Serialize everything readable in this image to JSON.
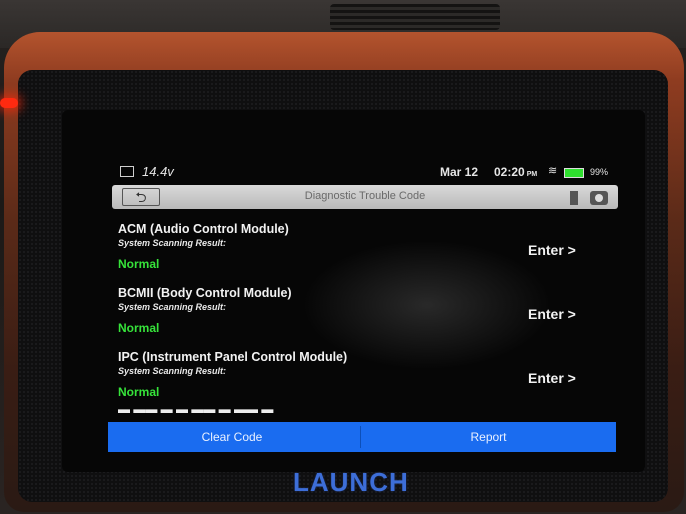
{
  "status_bar": {
    "voltage": "14.4v",
    "date": "Mar 12",
    "time": "02:20",
    "ampm": "PM",
    "battery": "99%"
  },
  "header": {
    "back_glyph": "⮌",
    "title": "Diagnostic Trouble Code"
  },
  "modules": [
    {
      "name": "ACM (Audio Control Module)",
      "sub": "System Scanning Result:",
      "status": "Normal",
      "enter": "Enter >"
    },
    {
      "name": "BCMII (Body Control Module)",
      "sub": "System Scanning Result:",
      "status": "Normal",
      "enter": "Enter >"
    },
    {
      "name": "IPC (Instrument Panel Control Module)",
      "sub": "System Scanning Result:",
      "status": "Normal",
      "enter": "Enter >"
    }
  ],
  "footer": {
    "clear_code": "Clear Code",
    "report": "Report"
  },
  "brand": "LAUNCH",
  "colors": {
    "accent": "#1a6cf0",
    "status_ok": "#36e33a",
    "shell": "#b4542e"
  }
}
